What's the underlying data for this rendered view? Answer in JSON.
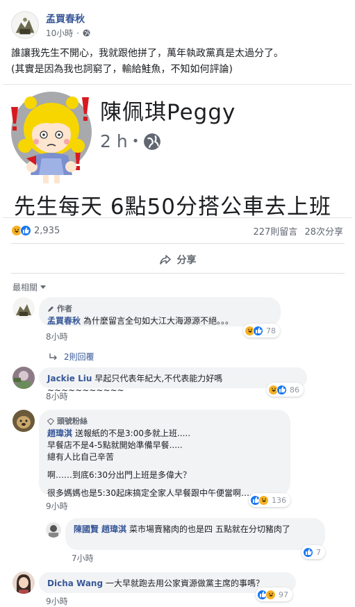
{
  "post": {
    "author": "孟買春秋",
    "time": "10小時",
    "text_line1": "誰讓我先生不開心，我就跟他拼了，萬年執政黨真是太過分了。",
    "text_line2": "(其實是因為我也詞窮了，輸給鮭魚，不知如何評論)"
  },
  "shared": {
    "name": "陳佩琪Peggy",
    "time": "2 h",
    "text": "先生每天 6點50分搭公車去上班"
  },
  "stats": {
    "reactions": "2,935",
    "comments": "227則留言",
    "shares": "28次分享"
  },
  "actions": {
    "share_label": "分享"
  },
  "sort": {
    "label": "最相關"
  },
  "comments": [
    {
      "badge": "作者",
      "name": "孟買春秋",
      "text": "為什麼留言全句如大江大海源源不絕。。。",
      "time": "8小時",
      "reactions": "78"
    },
    {
      "name": "Jackie Liu",
      "text": "早起只代表年紀大,不代表能力好嗎~~~~~~~~~~~",
      "time": "8小時",
      "reactions": "86"
    },
    {
      "badge": "頭號粉絲",
      "name": "趙瑋淇",
      "lines": [
        "送報紙的不是3:00多就上班.....",
        "早餐店不是4-5點就開始準備早餐.....",
        "總有人比自己辛苦",
        "啊……到底6:30分出門上班是多偉大？",
        "很多媽媽也是5:30起床搞定全家人早餐跟中午便當啊……"
      ],
      "time": "9小時",
      "reactions": "136"
    },
    {
      "name": "陳國賢",
      "tag": "趙瑋淇",
      "text": "菜市場賣豬肉的也是四 五點就在分切豬肉了",
      "time": "7小時",
      "reactions": "7"
    },
    {
      "name": "Dicha Wang",
      "text": "一大早就跑去用公家資源做黨主席的事嗎？",
      "time": "9小時",
      "reactions": "97"
    }
  ],
  "replies": {
    "label": "2則回覆"
  },
  "colors": {
    "link": "#385898",
    "like": "#1877f2",
    "haha": "#f7b125",
    "bubble": "#f2f3f5"
  }
}
